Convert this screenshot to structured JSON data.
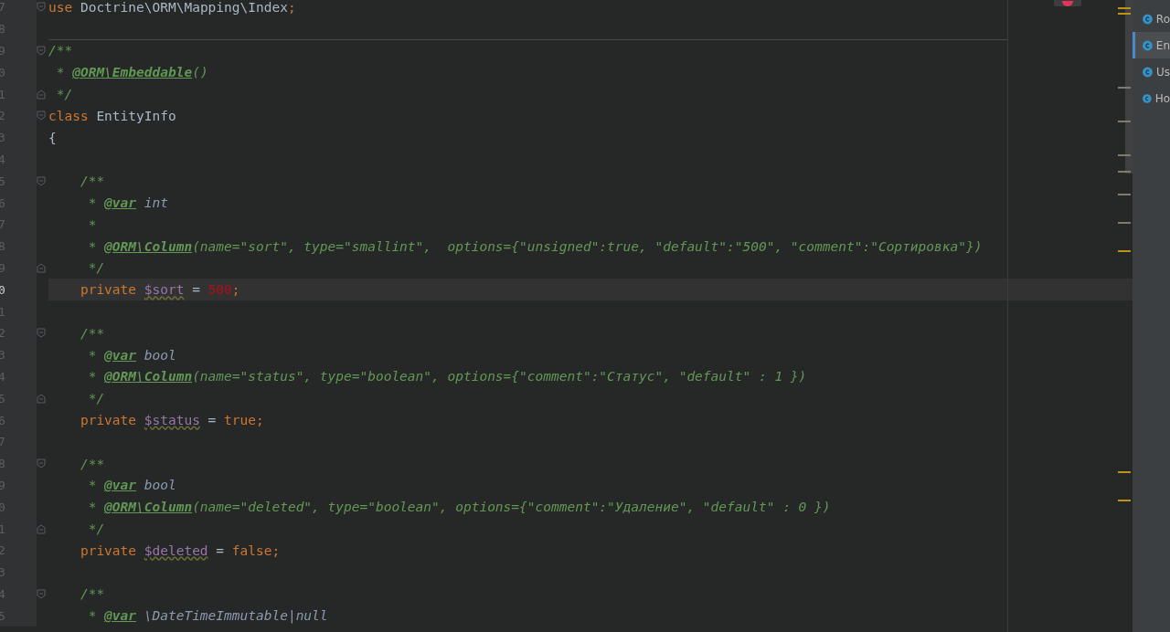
{
  "editor": {
    "lines": [
      {
        "number": "7",
        "fold_start": true,
        "fold_end": false,
        "current": false,
        "separator_below": false,
        "tokens": [
          {
            "kind": "keyword",
            "text": "use"
          },
          {
            "kind": "text",
            "text": " Doctrine\\ORM\\Mapping\\Index"
          },
          {
            "kind": "keyword",
            "text": ";"
          }
        ]
      },
      {
        "number": "8",
        "fold_start": false,
        "fold_end": false,
        "current": false,
        "separator_below": true
      },
      {
        "number": "9",
        "fold_start": true,
        "fold_end": false,
        "current": false,
        "separator_below": false,
        "tokens": [
          {
            "kind": "comment",
            "text": "/**"
          }
        ]
      },
      {
        "number": "0",
        "fold_start": false,
        "fold_end": false,
        "current": false,
        "separator_below": false,
        "tokens": [
          {
            "kind": "comment",
            "text": " * "
          },
          {
            "kind": "annotation",
            "text": "@ORM\\Embeddable"
          },
          {
            "kind": "comment",
            "text": "()"
          }
        ]
      },
      {
        "number": "1",
        "fold_start": false,
        "fold_end": true,
        "current": false,
        "separator_below": false,
        "tokens": [
          {
            "kind": "comment",
            "text": " */"
          }
        ]
      },
      {
        "number": "2",
        "fold_start": true,
        "fold_end": false,
        "current": false,
        "separator_below": false,
        "tokens": [
          {
            "kind": "keyword",
            "text": "class"
          },
          {
            "kind": "text",
            "text": " EntityInfo"
          }
        ]
      },
      {
        "number": "3",
        "fold_start": false,
        "fold_end": false,
        "current": false,
        "separator_below": false,
        "tokens": [
          {
            "kind": "text",
            "text": "{"
          }
        ]
      },
      {
        "number": "4",
        "fold_start": false,
        "fold_end": false,
        "current": false,
        "separator_below": false
      },
      {
        "number": "5",
        "fold_start": true,
        "fold_end": false,
        "current": false,
        "separator_below": false,
        "tokens": [
          {
            "kind": "comment",
            "text": "    /**"
          }
        ]
      },
      {
        "number": "6",
        "fold_start": false,
        "fold_end": false,
        "current": false,
        "separator_below": false,
        "tokens": [
          {
            "kind": "comment",
            "text": "     * "
          },
          {
            "kind": "annotation",
            "text": "@var"
          },
          {
            "kind": "doc-type",
            "text": " int"
          }
        ]
      },
      {
        "number": "7",
        "fold_start": false,
        "fold_end": false,
        "current": false,
        "separator_below": false,
        "tokens": [
          {
            "kind": "comment",
            "text": "     *"
          }
        ]
      },
      {
        "number": "8",
        "fold_start": false,
        "fold_end": false,
        "current": false,
        "separator_below": false,
        "tokens": [
          {
            "kind": "comment",
            "text": "     * "
          },
          {
            "kind": "annotation",
            "text": "@ORM\\Column"
          },
          {
            "kind": "comment",
            "text": "(name=\"sort\", type=\"smallint\",  options={\"unsigned\":true, \"default\":\"500\", \"comment\":\"Сортировка\"})"
          }
        ]
      },
      {
        "number": "9",
        "fold_start": false,
        "fold_end": true,
        "current": false,
        "separator_below": false,
        "tokens": [
          {
            "kind": "comment",
            "text": "     */"
          }
        ]
      },
      {
        "number": "0",
        "fold_start": false,
        "fold_end": false,
        "current": true,
        "separator_below": false,
        "tokens": [
          {
            "kind": "keyword",
            "text": "    private "
          },
          {
            "kind": "variable",
            "text": "$sort"
          },
          {
            "kind": "text",
            "text": " = "
          },
          {
            "kind": "number",
            "text": "500"
          },
          {
            "kind": "keyword",
            "text": ";"
          }
        ]
      },
      {
        "number": "1",
        "fold_start": false,
        "fold_end": false,
        "current": false,
        "separator_below": false
      },
      {
        "number": "2",
        "fold_start": true,
        "fold_end": false,
        "current": false,
        "separator_below": false,
        "tokens": [
          {
            "kind": "comment",
            "text": "    /**"
          }
        ]
      },
      {
        "number": "3",
        "fold_start": false,
        "fold_end": false,
        "current": false,
        "separator_below": false,
        "tokens": [
          {
            "kind": "comment",
            "text": "     * "
          },
          {
            "kind": "annotation",
            "text": "@var"
          },
          {
            "kind": "doc-type",
            "text": " bool"
          }
        ]
      },
      {
        "number": "4",
        "fold_start": false,
        "fold_end": false,
        "current": false,
        "separator_below": false,
        "tokens": [
          {
            "kind": "comment",
            "text": "     * "
          },
          {
            "kind": "annotation",
            "text": "@ORM\\Column"
          },
          {
            "kind": "comment",
            "text": "(name=\"status\", type=\"boolean\", options={\"comment\":\"Статус\", \"default\" : 1 })"
          }
        ]
      },
      {
        "number": "5",
        "fold_start": false,
        "fold_end": true,
        "current": false,
        "separator_below": false,
        "tokens": [
          {
            "kind": "comment",
            "text": "     */"
          }
        ]
      },
      {
        "number": "6",
        "fold_start": false,
        "fold_end": false,
        "current": false,
        "separator_below": false,
        "tokens": [
          {
            "kind": "keyword",
            "text": "    private "
          },
          {
            "kind": "variable",
            "text": "$status"
          },
          {
            "kind": "text",
            "text": " = "
          },
          {
            "kind": "keyword",
            "text": "true;"
          }
        ]
      },
      {
        "number": "7",
        "fold_start": false,
        "fold_end": false,
        "current": false,
        "separator_below": false
      },
      {
        "number": "8",
        "fold_start": true,
        "fold_end": false,
        "current": false,
        "separator_below": false,
        "tokens": [
          {
            "kind": "comment",
            "text": "    /**"
          }
        ]
      },
      {
        "number": "9",
        "fold_start": false,
        "fold_end": false,
        "current": false,
        "separator_below": false,
        "tokens": [
          {
            "kind": "comment",
            "text": "     * "
          },
          {
            "kind": "annotation",
            "text": "@var"
          },
          {
            "kind": "doc-type",
            "text": " bool"
          }
        ]
      },
      {
        "number": "0",
        "fold_start": false,
        "fold_end": false,
        "current": false,
        "separator_below": false,
        "tokens": [
          {
            "kind": "comment",
            "text": "     * "
          },
          {
            "kind": "annotation",
            "text": "@ORM\\Column"
          },
          {
            "kind": "comment",
            "text": "(name=\"deleted\", type=\"boolean\", options={\"comment\":\"Удаление\", \"default\" : 0 })"
          }
        ]
      },
      {
        "number": "1",
        "fold_start": false,
        "fold_end": true,
        "current": false,
        "separator_below": false,
        "tokens": [
          {
            "kind": "comment",
            "text": "     */"
          }
        ]
      },
      {
        "number": "2",
        "fold_start": false,
        "fold_end": false,
        "current": false,
        "separator_below": false,
        "tokens": [
          {
            "kind": "keyword",
            "text": "    private "
          },
          {
            "kind": "variable",
            "text": "$deleted"
          },
          {
            "kind": "text",
            "text": " = "
          },
          {
            "kind": "keyword",
            "text": "false;"
          }
        ]
      },
      {
        "number": "3",
        "fold_start": false,
        "fold_end": false,
        "current": false,
        "separator_below": false
      },
      {
        "number": "4",
        "fold_start": true,
        "fold_end": false,
        "current": false,
        "separator_below": false,
        "tokens": [
          {
            "kind": "comment",
            "text": "    /**"
          }
        ]
      },
      {
        "number": "5",
        "fold_start": false,
        "fold_end": false,
        "current": false,
        "separator_below": false,
        "tokens": [
          {
            "kind": "comment",
            "text": "     * "
          },
          {
            "kind": "annotation",
            "text": "@var"
          },
          {
            "kind": "doc-type",
            "text": " \\DateTimeImmutable|null"
          }
        ]
      }
    ]
  },
  "structure_panel": {
    "items": [
      {
        "label": "Ro",
        "selected": false
      },
      {
        "label": "En",
        "selected": true
      },
      {
        "label": "Us",
        "selected": false
      },
      {
        "label": "Ho",
        "selected": false
      }
    ]
  }
}
